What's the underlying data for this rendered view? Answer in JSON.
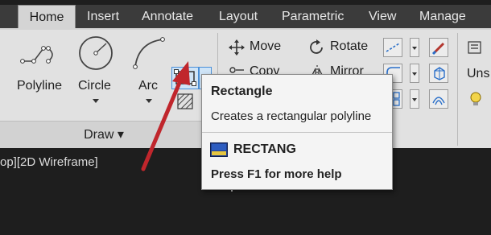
{
  "tabs": [
    {
      "label": "Home",
      "active": true
    },
    {
      "label": "Insert",
      "active": false
    },
    {
      "label": "Annotate",
      "active": false
    },
    {
      "label": "Layout",
      "active": false
    },
    {
      "label": "Parametric",
      "active": false
    },
    {
      "label": "View",
      "active": false
    },
    {
      "label": "Manage",
      "active": false
    }
  ],
  "draw_panel": {
    "title": "Draw ▾",
    "tools": {
      "polyline": "Polyline",
      "circle": "Circle",
      "arc": "Arc"
    }
  },
  "modify_panel": {
    "move": "Move",
    "rotate": "Rotate",
    "copy": "Copy",
    "mirror": "Mirror"
  },
  "right_cut_text": "Uns",
  "viewport_label": "op][2D Wireframe]",
  "tooltip": {
    "title": "Rectangle",
    "description": "Creates a rectangular polyline",
    "command": "RECTANG",
    "help": "Press F1 for more help"
  },
  "colors": {
    "ribbon_bg": "#e1e1e1",
    "tabbar_bg": "#3b3b3b",
    "canvas_bg": "#1e1e1e",
    "highlight": "#cfe4f7",
    "annotation_arrow": "#c0262c"
  }
}
